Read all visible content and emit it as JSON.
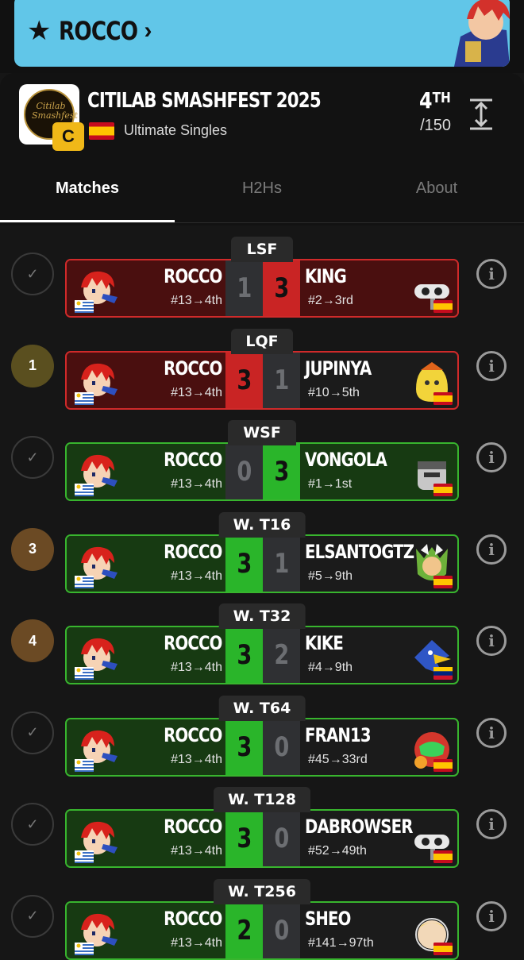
{
  "player": {
    "name": "ROCCO"
  },
  "event": {
    "title": "CITILAB SMASHFEST 2025",
    "tier": "C",
    "subtitle": "Ultimate Singles",
    "placing": "4",
    "placing_suffix": "TH",
    "total": "/150",
    "logo_text": "Citilab Smashfest"
  },
  "tabs": [
    {
      "label": "Matches"
    },
    {
      "label": "H2Hs"
    },
    {
      "label": "About"
    }
  ],
  "colors": {
    "banner": "#61c6e8",
    "win": "#2ab52a",
    "loss": "#c92424",
    "seed_1": "#5a4f1f",
    "seed_3": "#6b4a24"
  },
  "matches": [
    {
      "round": "LSF",
      "status": "check",
      "left": {
        "name": "ROCCO",
        "seed": "#13→4th"
      },
      "right": {
        "name": "KING",
        "seed": "#2→3rd"
      },
      "score_l": "1",
      "score_r": "3"
    },
    {
      "round": "LQF",
      "status": "1",
      "left": {
        "name": "ROCCO",
        "seed": "#13→4th"
      },
      "right": {
        "name": "JUPINYA",
        "seed": "#10→5th"
      },
      "score_l": "3",
      "score_r": "1"
    },
    {
      "round": "WSF",
      "status": "check",
      "left": {
        "name": "ROCCO",
        "seed": "#13→4th"
      },
      "right": {
        "name": "VONGOLA",
        "seed": "#1→1st"
      },
      "score_l": "0",
      "score_r": "3"
    },
    {
      "round": "W. T16",
      "status": "3",
      "left": {
        "name": "ROCCO",
        "seed": "#13→4th"
      },
      "right": {
        "name": "ELSANTOGTZ",
        "seed": "#5→9th"
      },
      "score_l": "3",
      "score_r": "1"
    },
    {
      "round": "W. T32",
      "status": "4",
      "left": {
        "name": "ROCCO",
        "seed": "#13→4th"
      },
      "right": {
        "name": "KIKE",
        "seed": "#4→9th"
      },
      "score_l": "3",
      "score_r": "2"
    },
    {
      "round": "W. T64",
      "status": "check",
      "left": {
        "name": "ROCCO",
        "seed": "#13→4th"
      },
      "right": {
        "name": "FRAN13",
        "seed": "#45→33rd"
      },
      "score_l": "3",
      "score_r": "0"
    },
    {
      "round": "W. T128",
      "status": "check",
      "left": {
        "name": "ROCCO",
        "seed": "#13→4th"
      },
      "right": {
        "name": "DABROWSER",
        "seed": "#52→49th"
      },
      "score_l": "3",
      "score_r": "0"
    },
    {
      "round": "W. T256",
      "status": "check",
      "left": {
        "name": "ROCCO",
        "seed": "#13→4th"
      },
      "right": {
        "name": "SHEO",
        "seed": "#141→97th"
      },
      "score_l": "2",
      "score_r": "0"
    }
  ],
  "icons": {
    "star": "star-icon",
    "chevron": "chevron-right-icon",
    "expand": "expand-vertical-icon",
    "info": "info-icon",
    "check": "check-icon"
  }
}
